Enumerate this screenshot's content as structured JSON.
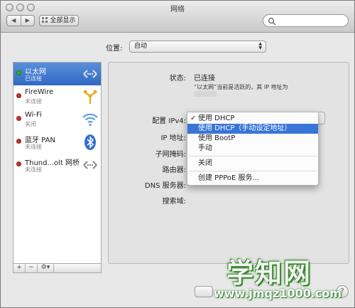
{
  "window": {
    "title": "网络"
  },
  "toolbar": {
    "back": "◀",
    "forward": "▶",
    "show_all": "全部显示",
    "search_placeholder": ""
  },
  "location": {
    "label": "位置:",
    "value": "自动"
  },
  "services": [
    {
      "name": "以太网",
      "status": "已连接",
      "status_color": "#2fb52f",
      "icon": "ethernet-icon",
      "selected": true
    },
    {
      "name": "FireWire",
      "status": "未连接",
      "status_color": "#d32f2f",
      "icon": "firewire-icon",
      "selected": false
    },
    {
      "name": "Wi-Fi",
      "status": "关闭",
      "status_color": "#d32f2f",
      "icon": "wifi-icon",
      "selected": false
    },
    {
      "name": "蓝牙 PAN",
      "status": "未连接",
      "status_color": "#d32f2f",
      "icon": "bluetooth-icon",
      "selected": false
    },
    {
      "name": "Thund...olt 网桥",
      "status": "未连接",
      "status_color": "#d32f2f",
      "icon": "thunderbolt-bridge-icon",
      "selected": false
    }
  ],
  "sidebar_buttons": {
    "add": "+",
    "remove": "−",
    "gear": "⚙▾"
  },
  "detail": {
    "status_label": "状态:",
    "status_value": "已连接",
    "status_desc": "“以太网”当前是活跃的，其 IP 地址为",
    "configure_label": "配置 IPv4:",
    "ip_label": "IP 地址:",
    "subnet_label": "子网掩码:",
    "router_label": "路由器:",
    "dns_label": "DNS 服务器:",
    "search_domain_label": "搜索域:"
  },
  "ipv4_menu": {
    "items": [
      "使用 DHCP",
      "使用 DHCP（手动设定地址）",
      "使用 BootP",
      "手动",
      "关闭",
      "创建 PPPoE 服务..."
    ],
    "checked_index": 0,
    "highlighted_index": 1,
    "check_mark": "✓"
  },
  "help": "?",
  "watermark": {
    "title": "学知网",
    "url": "www.jmqz1000.com"
  },
  "colors": {
    "selection": "#3875d7",
    "sidebar_selected": "#3f78cf",
    "watermark_green": "#3d8f2f"
  }
}
